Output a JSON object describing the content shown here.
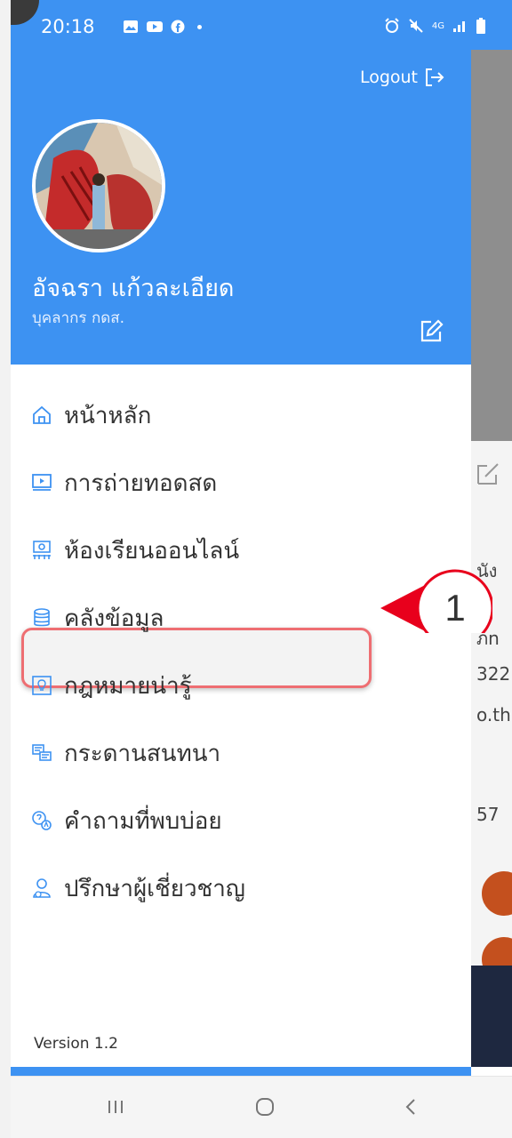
{
  "status_bar": {
    "time": "20:18",
    "network_label": "4G"
  },
  "drawer": {
    "logout_label": "Logout",
    "user": {
      "name": "อัจฉรา แก้วละเอียด",
      "role": "บุคลากร กดส."
    },
    "menu": [
      {
        "label": "หน้าหลัก",
        "icon": "home-icon"
      },
      {
        "label": "การถ่ายทอดสด",
        "icon": "live-video-icon"
      },
      {
        "label": "ห้องเรียนออนไลน์",
        "icon": "online-classroom-icon"
      },
      {
        "label": "คลังข้อมูล",
        "icon": "database-icon"
      },
      {
        "label": "กฎหมายน่ารู้",
        "icon": "law-lightbulb-icon"
      },
      {
        "label": "กระดานสนทนา",
        "icon": "chat-board-icon"
      },
      {
        "label": "คำถามที่พบบ่อย",
        "icon": "faq-icon"
      },
      {
        "label": "ปรึกษาผู้เชี่ยวชาญ",
        "icon": "expert-consult-icon"
      }
    ],
    "version": "Version 1.2"
  },
  "annotation": {
    "number": "1"
  },
  "background_partial": {
    "text": [
      "นัง",
      "ภn",
      "322",
      "o.th",
      "57"
    ]
  },
  "colors": {
    "header_blue": "#3d92f2",
    "highlight_border": "#ee6e72",
    "callout_red": "#e8001c"
  }
}
